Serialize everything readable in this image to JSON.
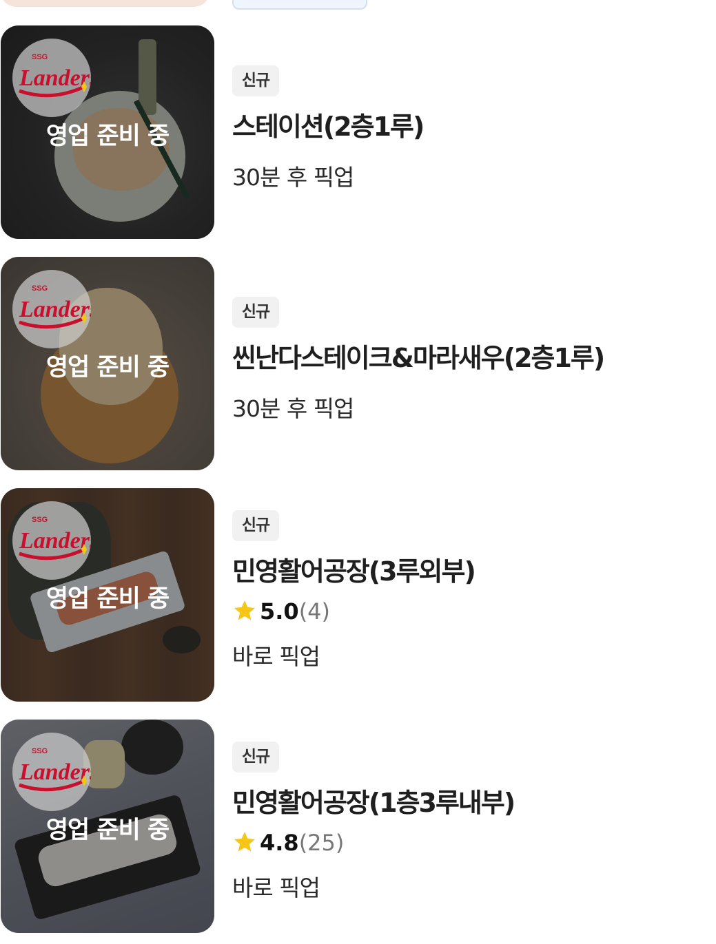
{
  "stores": [
    {
      "status_overlay": "영업 준비 중",
      "badge": "신규",
      "name": "스테이션(2층1루)",
      "pickup": "30분 후 픽업",
      "logo": "ssg-landers-logo"
    },
    {
      "status_overlay": "영업 준비 중",
      "badge": "신규",
      "name": "씬난다스테이크&마라새우(2층1루)",
      "pickup": "30분 후 픽업",
      "logo": "ssg-landers-logo"
    },
    {
      "status_overlay": "영업 준비 중",
      "badge": "신규",
      "name": "민영활어공장(3루외부)",
      "rating": "5.0",
      "rating_count": "(4)",
      "pickup": "바로 픽업",
      "logo": "ssg-landers-logo"
    },
    {
      "status_overlay": "영업 준비 중",
      "badge": "신규",
      "name": "민영활어공장(1층3루내부)",
      "rating": "4.8",
      "rating_count": "(25)",
      "pickup": "바로 픽업",
      "logo": "ssg-landers-logo"
    }
  ],
  "colors": {
    "badge_bg": "#f1f1f1",
    "star": "#f5c518",
    "logo_red": "#c8102e",
    "rating_count": "#777777"
  },
  "icons": {
    "rating": "star-icon",
    "logo": "ssg-landers-logo"
  }
}
